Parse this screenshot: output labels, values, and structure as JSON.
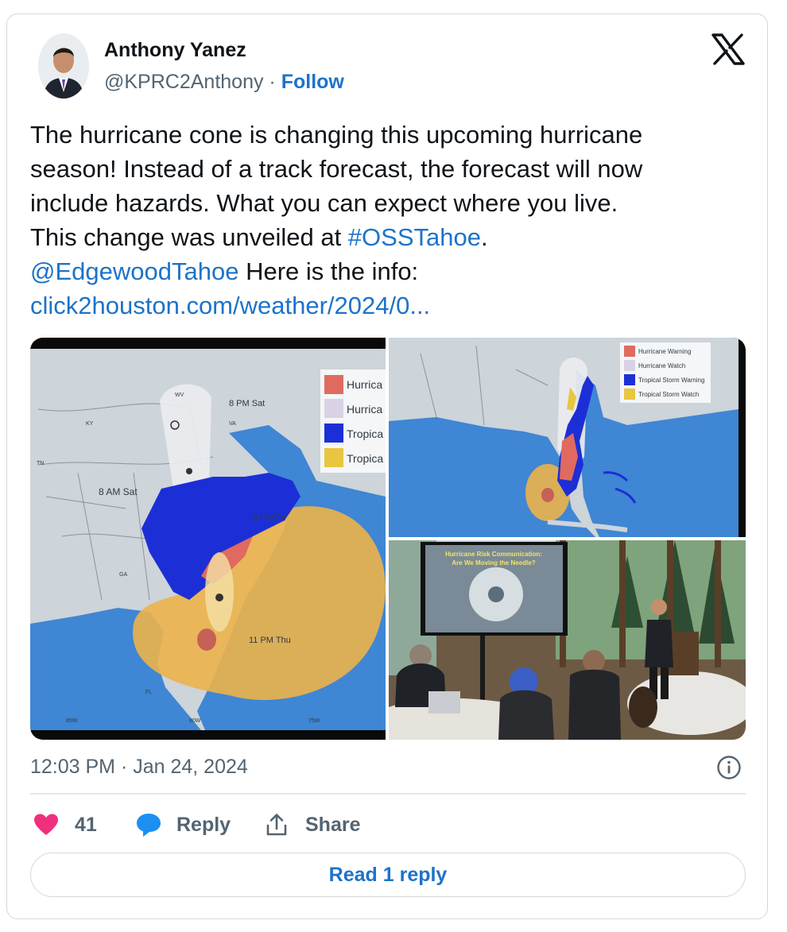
{
  "author": {
    "name": "Anthony Yanez",
    "handle": "@KPRC2Anthony",
    "separator": " · ",
    "follow_label": "Follow"
  },
  "tweet": {
    "line1": "The hurricane cone is changing this upcoming hurricane",
    "line2": "season! Instead of a track forecast, the forecast will now",
    "line3": "include hazards. What you can expect where you live.",
    "line4_prefix": "This change was unveiled at ",
    "hashtag": "#OSSTahoe",
    "line4_suffix": ".",
    "mention": "@EdgewoodTahoe",
    "line5_suffix": " Here is the info:",
    "url": "click2houston.com/weather/2024/0..."
  },
  "media": {
    "photo1": {
      "labels": {
        "legend": [
          "Hurrica",
          "Hurrica",
          "Tropica",
          "Tropica"
        ],
        "times": [
          "8 PM Sat",
          "8 AM Sat",
          "8 PM Fri",
          "11 PM Thu"
        ],
        "states": [
          "WV",
          "KY",
          "VA",
          "TN",
          "GA",
          "FL"
        ],
        "longitudes": [
          "85W",
          "80W",
          "75W"
        ]
      }
    },
    "photo2": {
      "legend": [
        "Hurricane Warning",
        "Hurricane Watch",
        "Tropical Storm Warning",
        "Tropical Storm Watch"
      ]
    },
    "photo3": {
      "screen_title_1": "Hurricane Risk Communication:",
      "screen_title_2": "Are We Moving the Needle?"
    }
  },
  "colors": {
    "hurricane_warning": "#e06a5f",
    "hurricane_watch": "#d9d2e4",
    "tropical_storm_warning": "#1c2fd6",
    "tropical_storm_watch": "#e8c640",
    "cone": "#ecb24a",
    "water": "#3f86d4",
    "land": "#cfd6dc",
    "link": "#1d73c9"
  },
  "timestamp": "12:03 PM · Jan 24, 2024",
  "actions": {
    "likes_count": "41",
    "reply_label": "Reply",
    "share_label": "Share"
  },
  "read_replies_label": "Read 1 reply",
  "icons": {
    "x": "x-logo-icon",
    "info": "info-icon",
    "heart": "heart-icon",
    "reply": "reply-bubble-icon",
    "share": "share-icon"
  }
}
